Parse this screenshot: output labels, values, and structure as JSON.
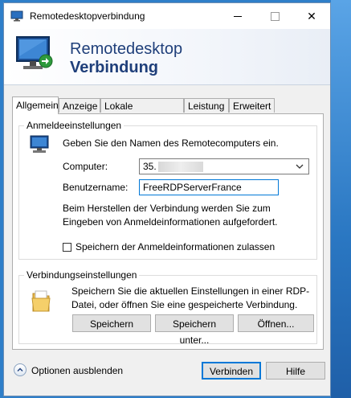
{
  "window": {
    "title": "Remotedesktopverbindung",
    "close_glyph": "✕"
  },
  "banner": {
    "line1": "Remotedesktop",
    "line2": "Verbindung"
  },
  "tabs": [
    {
      "label": "Allgemein",
      "active": true
    },
    {
      "label": "Anzeige",
      "active": false
    },
    {
      "label": "Lokale Ressourcen",
      "active": false
    },
    {
      "label": "Leistung",
      "active": false
    },
    {
      "label": "Erweitert",
      "active": false
    }
  ],
  "login_group": {
    "title": "Anmeldeeinstellungen",
    "intro": "Geben Sie den Namen des Remotecomputers ein.",
    "computer_label": "Computer:",
    "computer_value": "35.",
    "username_label": "Benutzername:",
    "username_value": "FreeRDPServerFrance",
    "info": "Beim Herstellen der Verbindung werden Sie zum Eingeben von Anmeldeinformationen aufgefordert.",
    "save_credentials_label": "Speichern der Anmeldeinformationen zulassen",
    "save_credentials_checked": false
  },
  "connection_group": {
    "title": "Verbindungseinstellungen",
    "description": "Speichern Sie die aktuellen Einstellungen in einer RDP-Datei, oder öffnen Sie eine gespeicherte Verbindung.",
    "save_label": "Speichern",
    "save_as_label": "Speichern unter...",
    "open_label": "Öffnen..."
  },
  "footer": {
    "options_label": "Optionen ausblenden",
    "connect_label": "Verbinden",
    "help_label": "Hilfe"
  },
  "colors": {
    "banner_text": "#1f3f7a",
    "focus_border": "#0078d7",
    "desktop": "#2f7fc9"
  }
}
